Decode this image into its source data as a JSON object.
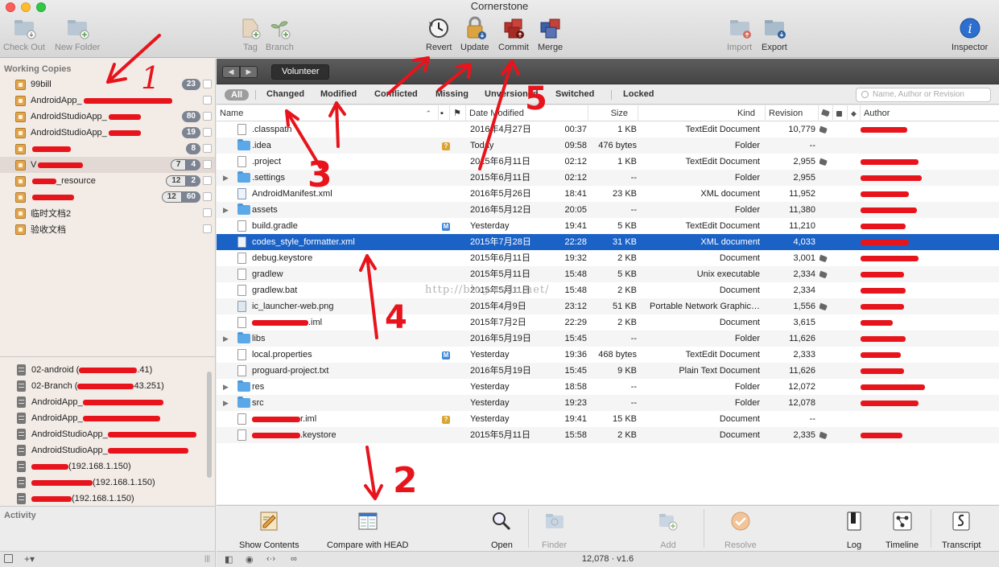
{
  "window": {
    "title": "Cornerstone"
  },
  "toolbar": {
    "check_out": "Check Out",
    "new_folder": "New Folder",
    "tag": "Tag",
    "branch": "Branch",
    "revert": "Revert",
    "update": "Update",
    "commit": "Commit",
    "merge": "Merge",
    "import": "Import",
    "export": "Export",
    "inspector": "Inspector"
  },
  "sidebar": {
    "working_copies_title": "Working Copies",
    "working_copies": [
      {
        "name": "99bill",
        "badge": "23"
      },
      {
        "name": "AndroidApp_"
      },
      {
        "name": "AndroidStudioApp_",
        "badge": "80"
      },
      {
        "name": "AndroidStudioApp_",
        "badge": "19"
      },
      {
        "name": "",
        "badge": "8"
      },
      {
        "name": "V",
        "badge_left": "7",
        "badge_right": "4"
      },
      {
        "name": "_resource",
        "badge_left": "12",
        "badge_right": "2"
      },
      {
        "name": "",
        "badge_left": "12",
        "badge_right": "60"
      },
      {
        "name": "临时文档2"
      },
      {
        "name": "验收文档"
      }
    ],
    "servers": [
      {
        "name": "02-android (",
        "suffix": ".41)"
      },
      {
        "name": "02-Branch (",
        "suffix": "43.251)"
      },
      {
        "name": "AndroidApp_"
      },
      {
        "name": "AndroidApp_"
      },
      {
        "name": "AndroidStudioApp_"
      },
      {
        "name": "AndroidStudioApp_"
      },
      {
        "name": "",
        "suffix": "(192.168.1.150)"
      },
      {
        "name": "",
        "suffix": "(192.168.1.150)"
      },
      {
        "name": "",
        "suffix": "(192.168.1.150)"
      }
    ],
    "activity_title": "Activity",
    "bottom_add": "+▾",
    "bottom_resize": "|||"
  },
  "pathbar": {
    "back": "◀",
    "forward": "▶",
    "crumb": "Volunteer"
  },
  "filters": {
    "all": "All",
    "changed": "Changed",
    "modified": "Modified",
    "conflicted": "Conflicted",
    "missing": "Missing",
    "unversioned": "Unversioned",
    "switched": "Switched",
    "locked": "Locked",
    "search_placeholder": "Name, Author or Revision"
  },
  "columns": {
    "name": "Name",
    "date_modified": "Date Modified",
    "size": "Size",
    "kind": "Kind",
    "revision": "Revision",
    "author": "Author"
  },
  "files": [
    {
      "name": ".classpath",
      "icon": "doc",
      "date": "2016年4月27日",
      "time": "00:37",
      "size": "1 KB",
      "kind": "TextEdit Document",
      "rev": "10,779",
      "tag": true
    },
    {
      "name": ".idea",
      "icon": "folder",
      "status": "?",
      "date": "Today",
      "time": "09:58",
      "size": "476 bytes",
      "kind": "Folder",
      "rev": "--"
    },
    {
      "name": ".project",
      "icon": "doc",
      "date": "2015年6月11日",
      "time": "02:12",
      "size": "1 KB",
      "kind": "TextEdit Document",
      "rev": "2,955",
      "tag": true
    },
    {
      "name": ".settings",
      "icon": "folder",
      "disclosure": true,
      "date": "2015年6月11日",
      "time": "02:12",
      "size": "--",
      "kind": "Folder",
      "rev": "2,955"
    },
    {
      "name": "AndroidManifest.xml",
      "icon": "xml",
      "date": "2016年5月26日",
      "time": "18:41",
      "size": "23 KB",
      "kind": "XML document",
      "rev": "11,952"
    },
    {
      "name": "assets",
      "icon": "folder",
      "disclosure": true,
      "date": "2016年5月12日",
      "time": "20:05",
      "size": "--",
      "kind": "Folder",
      "rev": "11,380"
    },
    {
      "name": "build.gradle",
      "icon": "doc",
      "status": "M",
      "date": "Yesterday",
      "time": "19:41",
      "size": "5 KB",
      "kind": "TextEdit Document",
      "rev": "11,210"
    },
    {
      "name": "codes_style_formatter.xml",
      "icon": "xml",
      "selected": true,
      "date": "2015年7月28日",
      "time": "22:28",
      "size": "31 KB",
      "kind": "XML document",
      "rev": "4,033"
    },
    {
      "name": "debug.keystore",
      "icon": "doc",
      "date": "2015年6月11日",
      "time": "19:32",
      "size": "2 KB",
      "kind": "Document",
      "rev": "3,001",
      "tag": true
    },
    {
      "name": "gradlew",
      "icon": "doc",
      "date": "2015年5月11日",
      "time": "15:48",
      "size": "5 KB",
      "kind": "Unix executable",
      "rev": "2,334",
      "tag": true
    },
    {
      "name": "gradlew.bat",
      "icon": "doc",
      "date": "2015年5月11日",
      "time": "15:48",
      "size": "2 KB",
      "kind": "Document",
      "rev": "2,334"
    },
    {
      "name": "ic_launcher-web.png",
      "icon": "img",
      "date": "2015年4月9日",
      "time": "23:12",
      "size": "51 KB",
      "kind": "Portable Network Graphic…",
      "rev": "1,556",
      "tag": true
    },
    {
      "name": ".iml",
      "icon": "doc",
      "date": "2015年7月2日",
      "time": "22:29",
      "size": "2 KB",
      "kind": "Document",
      "rev": "3,615"
    },
    {
      "name": "libs",
      "icon": "folder",
      "disclosure": true,
      "date": "2016年5月19日",
      "time": "15:45",
      "size": "--",
      "kind": "Folder",
      "rev": "11,626"
    },
    {
      "name": "local.properties",
      "icon": "doc",
      "status": "M",
      "date": "Yesterday",
      "time": "19:36",
      "size": "468 bytes",
      "kind": "TextEdit Document",
      "rev": "2,333"
    },
    {
      "name": "proguard-project.txt",
      "icon": "doc",
      "date": "2016年5月19日",
      "time": "15:45",
      "size": "9 KB",
      "kind": "Plain Text Document",
      "rev": "11,626"
    },
    {
      "name": "res",
      "icon": "folder",
      "disclosure": true,
      "date": "Yesterday",
      "time": "18:58",
      "size": "--",
      "kind": "Folder",
      "rev": "12,072"
    },
    {
      "name": "src",
      "icon": "folder",
      "disclosure": true,
      "date": "Yesterday",
      "time": "19:23",
      "size": "--",
      "kind": "Folder",
      "rev": "12,078"
    },
    {
      "name": "r.iml",
      "icon": "doc",
      "status": "?",
      "date": "Yesterday",
      "time": "19:41",
      "size": "15 KB",
      "kind": "Document",
      "rev": "--"
    },
    {
      "name": ".keystore",
      "icon": "doc",
      "date": "2015年5月11日",
      "time": "15:58",
      "size": "2 KB",
      "kind": "Document",
      "rev": "2,335",
      "tag": true
    }
  ],
  "bottom_toolbar": {
    "show_contents": "Show Contents",
    "compare_with_head": "Compare with HEAD",
    "open": "Open",
    "finder": "Finder",
    "add": "Add",
    "resolve": "Resolve",
    "log": "Log",
    "timeline": "Timeline",
    "transcript": "Transcript"
  },
  "status": {
    "text": "12,078 · v1.6"
  },
  "annotations": {
    "n1": "1",
    "n2": "2",
    "n3": "3",
    "n4": "4",
    "n5": "5",
    "watermark": "http://blog.csdn.net/"
  },
  "colors": {
    "selection": "#1b62c6",
    "annotation": "#e8141c",
    "sidebar_bg": "#f2ebe6"
  }
}
